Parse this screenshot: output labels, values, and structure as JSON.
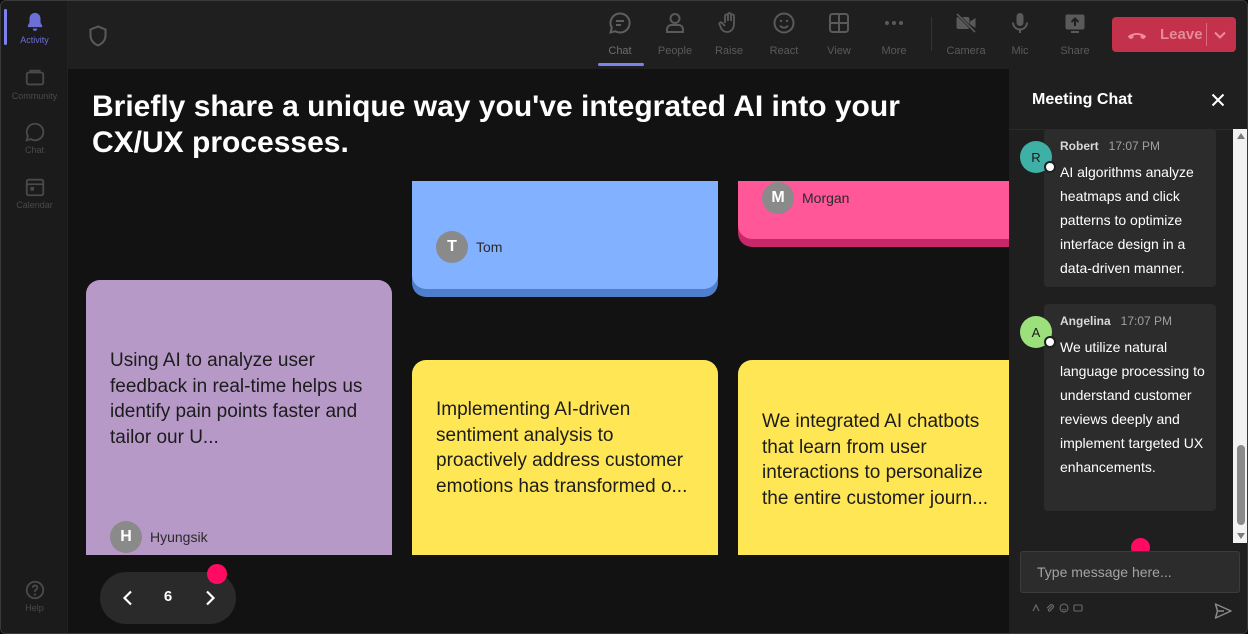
{
  "rail": {
    "items": [
      {
        "label": "Activity",
        "icon": "bell-icon"
      },
      {
        "label": "Community",
        "icon": "community-icon"
      },
      {
        "label": "Chat",
        "icon": "chat-icon"
      },
      {
        "label": "Calendar",
        "icon": "calendar-icon"
      },
      {
        "label": "Help",
        "icon": "help-icon"
      }
    ]
  },
  "toolbar": {
    "chat": "Chat",
    "people": "People",
    "raise": "Raise",
    "react": "React",
    "view": "View",
    "more": "More",
    "camera": "Camera",
    "mic": "Mic",
    "share": "Share",
    "leave": "Leave"
  },
  "stage": {
    "question": "Briefly share a unique way you've integrated AI into your CX/UX processes.",
    "cards": [
      {
        "author": "Tom",
        "initial": "T",
        "text": "",
        "color": "#82b1ff"
      },
      {
        "author": "Morgan",
        "initial": "M",
        "text": "",
        "color": "#ff5798"
      },
      {
        "author": "Hyungsik",
        "initial": "H",
        "text": "Using AI to analyze user feedback in real-time helps us identify pain points faster and tailor our U...",
        "color": "#b799c7"
      },
      {
        "author": "",
        "initial": "",
        "text": "Implementing AI-driven sentiment analysis to proactively address customer emotions has transformed o...",
        "color": "#ffe655"
      },
      {
        "author": "",
        "initial": "",
        "text": "We integrated AI chatbots that learn from user interactions to personalize the entire customer journ...",
        "color": "#ffe655"
      }
    ],
    "pager": {
      "page": "6"
    }
  },
  "chat": {
    "title": "Meeting Chat",
    "messages": [
      {
        "name": "Robert",
        "initial": "R",
        "time": "17:07 PM",
        "text": "AI algorithms analyze heatmaps and click patterns to optimize interface design in a data-driven manner.",
        "avatar_color": "#3fb0a5"
      },
      {
        "name": "Angelina",
        "initial": "A",
        "time": "17:07 PM",
        "text": "We utilize natural language processing to understand customer reviews deeply and implement targeted UX enhancements.",
        "avatar_color": "#9be07a"
      }
    ],
    "input_placeholder": "Type message here..."
  },
  "colors": {
    "accent": "#7b83eb",
    "leave": "#c4314b",
    "pink_dot": "#ff0b63"
  }
}
